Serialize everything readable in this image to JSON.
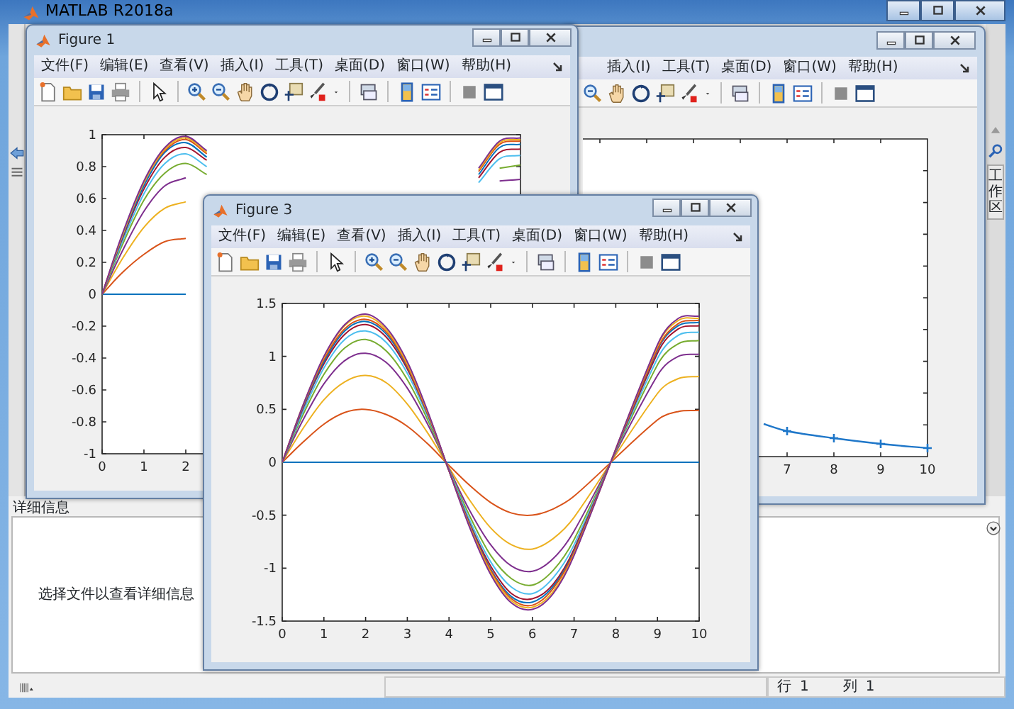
{
  "window": {
    "title": "MATLAB R2018a"
  },
  "background_figure": {
    "menu": [
      "插入(I)",
      "工具(T)",
      "桌面(D)",
      "窗口(W)",
      "帮助(H)"
    ],
    "x_tick_labels": [
      "7",
      "8",
      "9",
      "10"
    ]
  },
  "figures": [
    {
      "title": "Figure 1",
      "menu": [
        "文件(F)",
        "编辑(E)",
        "查看(V)",
        "插入(I)",
        "工具(T)",
        "桌面(D)",
        "窗口(W)",
        "帮助(H)"
      ],
      "chart_data": {
        "type": "line",
        "x": [
          0,
          0.5,
          1,
          1.5,
          2,
          2.5,
          9,
          9.5,
          10
        ],
        "xlim": [
          0,
          10
        ],
        "ylim": [
          -1,
          1
        ],
        "xticks": [
          0,
          1,
          2
        ],
        "yticks": [
          -1,
          -0.8,
          -0.6,
          -0.4,
          -0.2,
          0,
          0.2,
          0.4,
          0.6,
          0.8,
          1
        ],
        "series": [
          {
            "color": "#0072bd",
            "values": [
              0,
              0,
              0,
              0,
              0,
              null,
              null,
              null,
              null
            ]
          },
          {
            "color": "#d95319",
            "values": [
              0,
              0.14,
              0.25,
              0.33,
              0.35,
              null,
              null,
              null,
              null
            ]
          },
          {
            "color": "#edb120",
            "values": [
              0,
              0.23,
              0.42,
              0.54,
              0.58,
              null,
              null,
              null,
              null
            ]
          },
          {
            "color": "#7e2f8e",
            "values": [
              0,
              0.28,
              0.52,
              0.68,
              0.73,
              null,
              null,
              0.71,
              0.72
            ]
          },
          {
            "color": "#77ac30",
            "values": [
              0,
              0.32,
              0.59,
              0.76,
              0.82,
              0.75,
              null,
              0.79,
              0.81
            ]
          },
          {
            "color": "#4dbeee",
            "values": [
              0,
              0.34,
              0.63,
              0.82,
              0.88,
              0.8,
              0.7,
              0.85,
              0.87
            ]
          },
          {
            "color": "#a2142f",
            "values": [
              0,
              0.36,
              0.66,
              0.86,
              0.92,
              0.84,
              0.73,
              0.89,
              0.91
            ]
          },
          {
            "color": "#0072bd",
            "values": [
              0,
              0.37,
              0.68,
              0.89,
              0.95,
              0.86,
              0.75,
              0.92,
              0.94
            ]
          },
          {
            "color": "#d95319",
            "values": [
              0,
              0.38,
              0.7,
              0.9,
              0.97,
              0.88,
              0.77,
              0.94,
              0.96
            ]
          },
          {
            "color": "#edb120",
            "values": [
              0,
              0.38,
              0.7,
              0.91,
              0.98,
              0.89,
              0.78,
              0.95,
              0.97
            ]
          },
          {
            "color": "#7e2f8e",
            "values": [
              0,
              0.39,
              0.71,
              0.92,
              0.99,
              0.9,
              0.79,
              0.96,
              0.98
            ]
          }
        ]
      }
    },
    {
      "title": "Figure 3",
      "menu": [
        "文件(F)",
        "编辑(E)",
        "查看(V)",
        "插入(I)",
        "工具(T)",
        "桌面(D)",
        "窗口(W)",
        "帮助(H)"
      ],
      "chart_data": {
        "type": "line",
        "x": [
          0,
          0.5,
          1,
          1.5,
          2,
          2.5,
          3,
          3.5,
          4,
          4.5,
          5,
          5.5,
          6,
          6.5,
          7,
          9,
          9.5,
          10
        ],
        "xlim": [
          0,
          10
        ],
        "ylim": [
          -1.5,
          1.5
        ],
        "xticks": [
          0,
          1,
          2,
          3,
          4,
          5,
          6,
          7,
          8,
          9,
          10
        ],
        "yticks": [
          -1.5,
          -1,
          -0.5,
          0,
          0.5,
          1,
          1.5
        ],
        "series": [
          {
            "color": "#0072bd",
            "values": [
              0,
              0,
              0,
              0,
              0,
              0,
              0,
              0,
              0,
              0,
              0,
              0,
              0,
              0,
              0,
              0,
              0,
              0
            ]
          },
          {
            "color": "#d95319",
            "values": [
              0,
              0.19,
              0.36,
              0.47,
              0.5,
              0.45,
              0.34,
              0.17,
              -0.03,
              -0.22,
              -0.38,
              -0.48,
              -0.5,
              -0.44,
              -0.32,
              0.4,
              0.48,
              0.49
            ]
          },
          {
            "color": "#edb120",
            "values": [
              0,
              0.32,
              0.59,
              0.76,
              0.82,
              0.75,
              0.55,
              0.27,
              -0.05,
              -0.36,
              -0.62,
              -0.78,
              -0.82,
              -0.72,
              -0.52,
              0.65,
              0.79,
              0.81
            ]
          },
          {
            "color": "#7e2f8e",
            "values": [
              0,
              0.4,
              0.74,
              0.96,
              1.03,
              0.94,
              0.7,
              0.35,
              -0.06,
              -0.46,
              -0.78,
              -0.98,
              -1.03,
              -0.91,
              -0.65,
              0.82,
              1,
              1.02
            ]
          },
          {
            "color": "#77ac30",
            "values": [
              0,
              0.45,
              0.83,
              1.08,
              1.16,
              1.05,
              0.78,
              0.39,
              -0.07,
              -0.51,
              -0.88,
              -1.1,
              -1.16,
              -1.02,
              -0.73,
              0.92,
              1.12,
              1.15
            ]
          },
          {
            "color": "#4dbeee",
            "values": [
              0,
              0.48,
              0.89,
              1.16,
              1.24,
              1.13,
              0.84,
              0.42,
              -0.07,
              -0.55,
              -0.94,
              -1.18,
              -1.24,
              -1.09,
              -0.78,
              0.98,
              1.2,
              1.23
            ]
          },
          {
            "color": "#a2142f",
            "values": [
              0,
              0.51,
              0.93,
              1.21,
              1.3,
              1.18,
              0.88,
              0.44,
              -0.08,
              -0.58,
              -0.98,
              -1.24,
              -1.29,
              -1.15,
              -0.82,
              1.03,
              1.26,
              1.29
            ]
          },
          {
            "color": "#0072bd",
            "values": [
              0,
              0.52,
              0.95,
              1.24,
              1.33,
              1.21,
              0.9,
              0.45,
              -0.08,
              -0.59,
              -1.01,
              -1.27,
              -1.32,
              -1.17,
              -0.84,
              1.06,
              1.29,
              1.32
            ]
          },
          {
            "color": "#d95319",
            "values": [
              0,
              0.53,
              0.97,
              1.26,
              1.35,
              1.23,
              0.91,
              0.45,
              -0.08,
              -0.6,
              -1.02,
              -1.29,
              -1.35,
              -1.19,
              -0.85,
              1.07,
              1.31,
              1.34
            ]
          },
          {
            "color": "#edb120",
            "values": [
              0,
              0.54,
              0.99,
              1.29,
              1.38,
              1.25,
              0.93,
              0.46,
              -0.08,
              -0.61,
              -1.04,
              -1.31,
              -1.37,
              -1.22,
              -0.87,
              1.1,
              1.34,
              1.36
            ]
          },
          {
            "color": "#7e2f8e",
            "values": [
              0,
              0.54,
              1,
              1.3,
              1.4,
              1.27,
              0.95,
              0.47,
              -0.08,
              -0.62,
              -1.06,
              -1.33,
              -1.39,
              -1.24,
              -0.88,
              1.11,
              1.36,
              1.38
            ]
          }
        ]
      }
    }
  ],
  "side_tab": {
    "label": "工作区"
  },
  "details": {
    "header": "详细信息",
    "message": "选择文件以查看详细信息"
  },
  "status_bar": {
    "row_label": "行",
    "row": "1",
    "col_label": "列",
    "col": "1"
  }
}
